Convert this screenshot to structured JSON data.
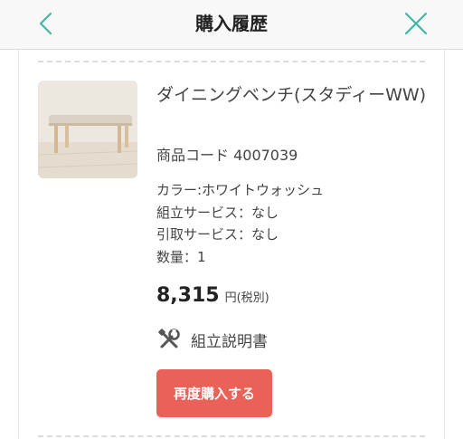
{
  "header": {
    "title": "購入履歴",
    "back_icon": "chevron-left-icon",
    "close_icon": "close-icon",
    "accent_color": "#3fb9a6"
  },
  "item": {
    "name": "ダイニングベンチ(スタディーWW)",
    "code": "商品コード 4007039",
    "attributes": [
      "カラー:ホワイトウォッシュ",
      "組立サービス：なし",
      "引取サービス：なし",
      "数量：1"
    ],
    "price": "8,315",
    "price_unit": "円(税別)",
    "manual_label": "組立説明書",
    "manual_icon": "tools-icon",
    "rebuy_label": "再度購入する",
    "rebuy_color": "#ea6158"
  }
}
